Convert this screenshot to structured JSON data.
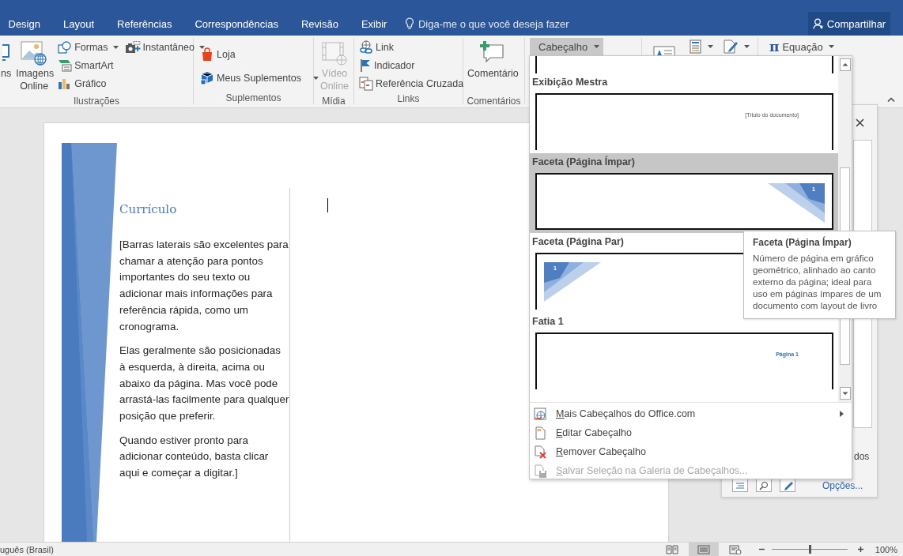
{
  "tabs": [
    {
      "label": "Design",
      "selected": false
    },
    {
      "label": "Layout",
      "selected": false
    },
    {
      "label": "Referências",
      "selected": false
    },
    {
      "label": "Correspondências",
      "selected": false
    },
    {
      "label": "Revisão",
      "selected": false
    },
    {
      "label": "Exibir",
      "selected": false
    }
  ],
  "tell_me": {
    "placeholder": "Diga-me o que você deseja fazer"
  },
  "share_button": "Compartilhar",
  "ribbon": {
    "groups": [
      {
        "label": "Ilustrações",
        "columns": [
          [
            {
              "kind": "large",
              "label": "ns",
              "dropdown": false,
              "disabled": false
            }
          ],
          [
            {
              "kind": "large",
              "label": "Imagens Online",
              "dropdown": false,
              "disabled": false
            }
          ],
          [
            {
              "kind": "small",
              "label": "Formas",
              "dropdown": true,
              "disabled": false
            },
            {
              "kind": "small",
              "label": "SmartArt",
              "dropdown": false,
              "disabled": false
            },
            {
              "kind": "small",
              "label": "Gráfico",
              "dropdown": false,
              "disabled": false
            }
          ],
          [
            {
              "kind": "small",
              "label": "Instantâneo",
              "dropdown": true,
              "disabled": false
            }
          ]
        ]
      },
      {
        "label": "Suplementos",
        "columns": [
          [
            {
              "kind": "small",
              "label": "Loja",
              "dropdown": false,
              "disabled": false
            },
            {
              "kind": "small",
              "label": "Meus Suplementos",
              "dropdown": true,
              "disabled": false
            }
          ]
        ]
      },
      {
        "label": "Mídia",
        "columns": [
          [
            {
              "kind": "large",
              "label": "Vídeo Online",
              "dropdown": false,
              "disabled": true
            }
          ]
        ]
      },
      {
        "label": "Links",
        "columns": [
          [
            {
              "kind": "small",
              "label": "Link",
              "dropdown": false,
              "disabled": false
            },
            {
              "kind": "small",
              "label": "Indicador",
              "dropdown": false,
              "disabled": false
            },
            {
              "kind": "small",
              "label": "Referência Cruzada",
              "dropdown": false,
              "disabled": false
            }
          ]
        ]
      },
      {
        "label": "Comentários",
        "columns": [
          [
            {
              "kind": "large",
              "label": "Comentário",
              "dropdown": false,
              "disabled": false
            }
          ]
        ]
      }
    ]
  },
  "header_button": {
    "label": "Cabeçalho",
    "pressed": true,
    "dropdown": true
  },
  "tools": [
    {
      "dropdown": false
    },
    {
      "dropdown": true
    },
    {
      "dropdown": true
    },
    {
      "symbol": "π",
      "label": "Equação",
      "dropdown": true
    }
  ],
  "document": {
    "title": "Currículo",
    "paragraphs": [
      "[Barras laterais são excelentes para chamar a atenção para pontos importantes do seu texto ou adicionar mais informações para referência rápida, como um cronograma.",
      "Elas geralmente são posicionadas à esquerda, à direita, acima ou abaixo da página. Mas você pode arrastá-las facilmente para qualquer posição que preferir.",
      "Quando estiver pronto para adicionar conteúdo, basta clicar aqui e começar a digitar.]"
    ]
  },
  "task_pane": {
    "partial_text": "dos",
    "link": "Opções..."
  },
  "header_gallery": {
    "items": [
      {
        "title": "Exibição Mestra",
        "selected": false,
        "kind": "master",
        "preview_text": "[Título do documento]"
      },
      {
        "title": "Faceta (Página Ímpar)",
        "selected": true,
        "kind": "facet_odd",
        "preview_text": "1"
      },
      {
        "title": "Faceta (Página Par)",
        "selected": false,
        "kind": "facet_even",
        "preview_text": "1"
      },
      {
        "title": "Fatia 1",
        "selected": false,
        "kind": "slice",
        "preview_text": "Página 1"
      }
    ]
  },
  "header_menu": {
    "items": [
      {
        "label": "Mais Cabeçalhos do Office.com",
        "disabled": false,
        "submenu": true
      },
      {
        "label": "Editar Cabeçalho",
        "disabled": false,
        "submenu": false
      },
      {
        "label": "Remover Cabeçalho",
        "disabled": false,
        "submenu": false
      },
      {
        "label": "Salvar Seleção na Galeria de Cabeçalhos...",
        "disabled": true,
        "submenu": false
      }
    ]
  },
  "tooltip": {
    "title": "Faceta (Página Ímpar)",
    "text": "Número de página em gráfico geométrico, alinhado ao canto externo da página; ideal para uso em páginas ímpares de um documento com layout de livro"
  },
  "status_bar": {
    "language": "uguês (Brasil)",
    "views": [
      {
        "selected": false
      },
      {
        "selected": true
      },
      {
        "selected": false
      }
    ],
    "zoom": {
      "level": 0.5,
      "label": "100%"
    }
  }
}
